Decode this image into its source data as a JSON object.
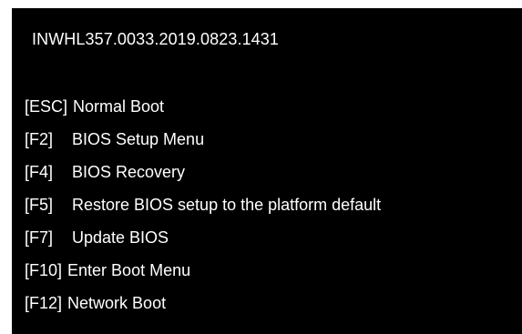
{
  "bios": {
    "version": "INWHL357.0033.2019.0823.1431"
  },
  "menu": {
    "items": [
      {
        "key": "[ESC]",
        "label": "Normal Boot"
      },
      {
        "key": "[F2]",
        "label": "BIOS Setup Menu"
      },
      {
        "key": "[F4]",
        "label": "BIOS Recovery"
      },
      {
        "key": "[F5]",
        "label": "Restore BIOS setup to the platform default"
      },
      {
        "key": "[F7]",
        "label": "Update BIOS"
      },
      {
        "key": "[F10]",
        "label": "Enter Boot Menu"
      },
      {
        "key": "[F12]",
        "label": "Network Boot"
      }
    ]
  },
  "colors": {
    "background": "#000000",
    "text": "#ffffff",
    "frame": "#ffffff"
  }
}
